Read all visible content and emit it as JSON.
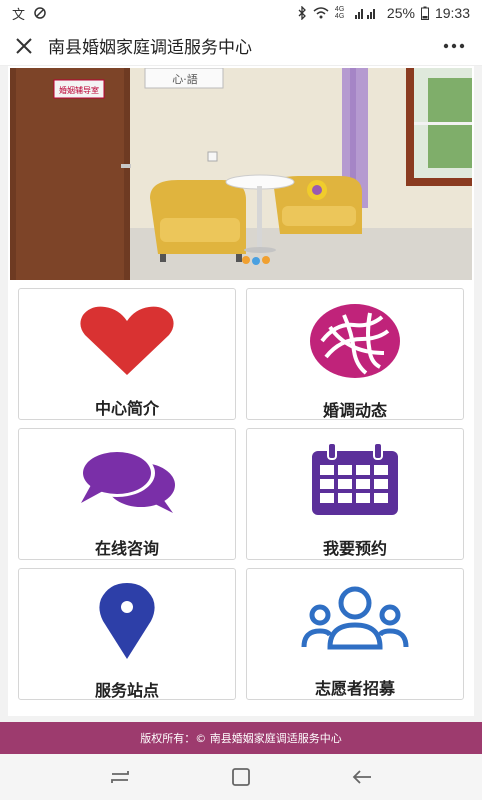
{
  "status_bar": {
    "network": "4G 4G",
    "battery": "25%",
    "time": "19:33"
  },
  "header": {
    "title": "南县婚姻家庭调适服务中心",
    "more_label": "•••"
  },
  "banner": {
    "door_sign": "婚姻辅导室",
    "wall_art": "心·語"
  },
  "tiles": [
    {
      "label": "中心简介",
      "icon": "heart-icon",
      "color": "#d93232"
    },
    {
      "label": "婚调动态",
      "icon": "network-globe-icon",
      "color": "#c0237a"
    },
    {
      "label": "在线咨询",
      "icon": "chat-bubbles-icon",
      "color": "#7a2fa8"
    },
    {
      "label": "我要预约",
      "icon": "calendar-icon",
      "color": "#5b2f9a"
    },
    {
      "label": "服务站点",
      "icon": "map-pin-icon",
      "color": "#2d3fa8"
    },
    {
      "label": "志愿者招募",
      "icon": "people-group-icon",
      "color": "#2f6fc4"
    }
  ],
  "footer": {
    "copyright": "版权所有：© 南县婚姻家庭调适服务中心"
  }
}
